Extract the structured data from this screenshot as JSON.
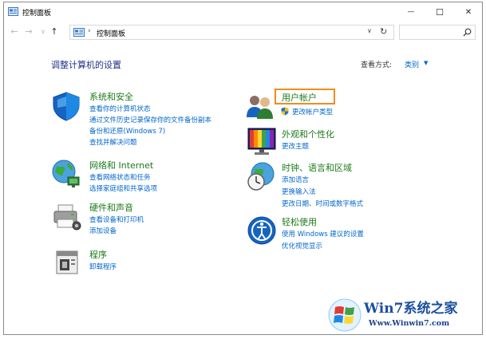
{
  "window": {
    "title": "控制面板",
    "minimize": "—",
    "maximize": "☐",
    "close": "✕"
  },
  "nav": {
    "back": "←",
    "forward": "→",
    "recent": "∨",
    "up": "↑",
    "separator": "›",
    "address": "控制面板",
    "address_dropdown": "∨",
    "refresh": "↻",
    "search_placeholder": ""
  },
  "main": {
    "title": "调整计算机的设置",
    "view_by_label": "查看方式:",
    "view_by_value": "类别",
    "view_by_arrow": "▼"
  },
  "categories": {
    "system": {
      "title": "系统和安全",
      "links": [
        "查看你的计算机状态",
        "通过文件历史记录保存你的文件备份副本",
        "备份和还原(Windows 7)",
        "查找并解决问题"
      ]
    },
    "network": {
      "title": "网络和 Internet",
      "links": [
        "查看网络状态和任务",
        "选择家庭组和共享选项"
      ]
    },
    "hardware": {
      "title": "硬件和声音",
      "links": [
        "查看设备和打印机",
        "添加设备"
      ]
    },
    "programs": {
      "title": "程序",
      "links": [
        "卸载程序"
      ]
    },
    "user_accounts": {
      "title": "用户帐户",
      "links": [
        "更改帐户类型"
      ]
    },
    "appearance": {
      "title": "外观和个性化",
      "links": [
        "更改主题"
      ]
    },
    "clock": {
      "title": "时钟、语言和区域",
      "links": [
        "添加语言",
        "更换输入法",
        "更改日期、时间或数字格式"
      ]
    },
    "ease": {
      "title": "轻松使用",
      "links": [
        "使用 Windows 建议的设置",
        "优化视觉显示"
      ]
    }
  },
  "watermark": {
    "brand": "Win7系统之家",
    "url": "Www.Winwin7.com"
  },
  "colors": {
    "category_title": "#1b7a1b",
    "link": "#0066cc",
    "page_title": "#1e3287",
    "highlight": "#f08c1e"
  }
}
